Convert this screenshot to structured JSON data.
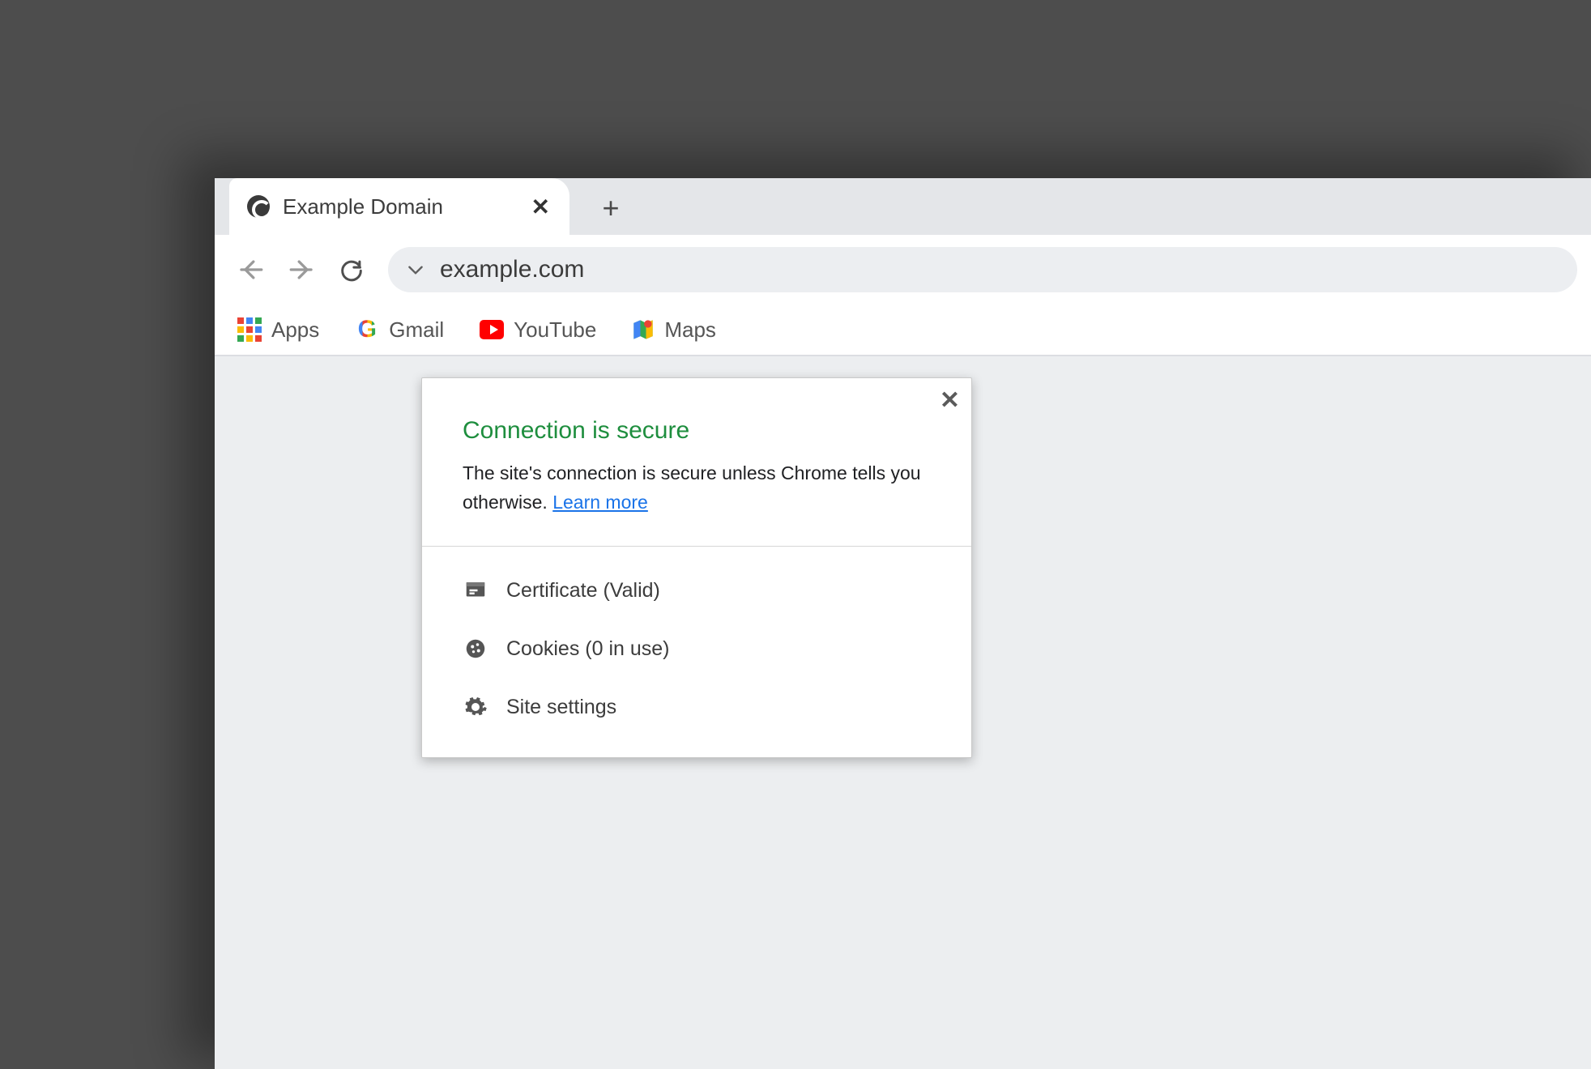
{
  "tab": {
    "title": "Example Domain"
  },
  "omnibox": {
    "url": "example.com"
  },
  "bookmarks": {
    "apps": {
      "label": "Apps"
    },
    "gmail": {
      "label": "Gmail"
    },
    "youtube": {
      "label": "YouTube"
    },
    "maps": {
      "label": "Maps"
    }
  },
  "site_info": {
    "title": "Connection is secure",
    "description_before": "The site's connection is secure unless Chrome tells you otherwise. ",
    "learn_more": "Learn more",
    "items": {
      "certificate": {
        "label": "Certificate (Valid)"
      },
      "cookies": {
        "label": "Cookies (0 in use)"
      },
      "settings": {
        "label": "Site settings"
      }
    }
  }
}
